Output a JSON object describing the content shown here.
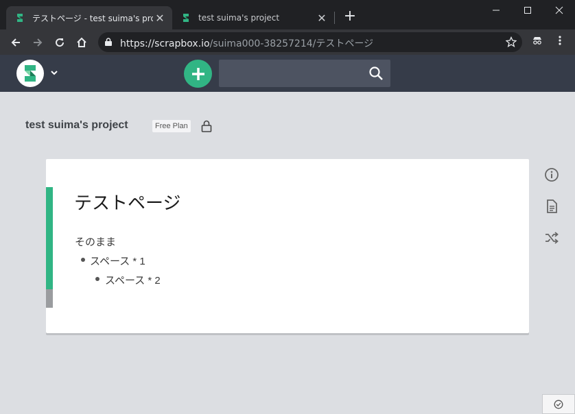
{
  "browser": {
    "tabs": [
      {
        "title": "テストページ - test suima's project",
        "close": "✕"
      },
      {
        "title": "test suima's project",
        "close": "✕"
      }
    ],
    "new_tab": "+",
    "url_host": "https://scrapbox.io",
    "url_path": "/suima000-38257214/テストページ"
  },
  "header": {
    "logo_icon": "scrapbox-logo",
    "new_page_icon": "plus-icon",
    "search_placeholder": "",
    "accent_color": "#31b584"
  },
  "project": {
    "title": "test suima's project",
    "plan": "Free Plan"
  },
  "page": {
    "title": "テストページ",
    "lines": [
      "そのまま",
      "スペース * 1",
      "スペース * 2"
    ]
  }
}
